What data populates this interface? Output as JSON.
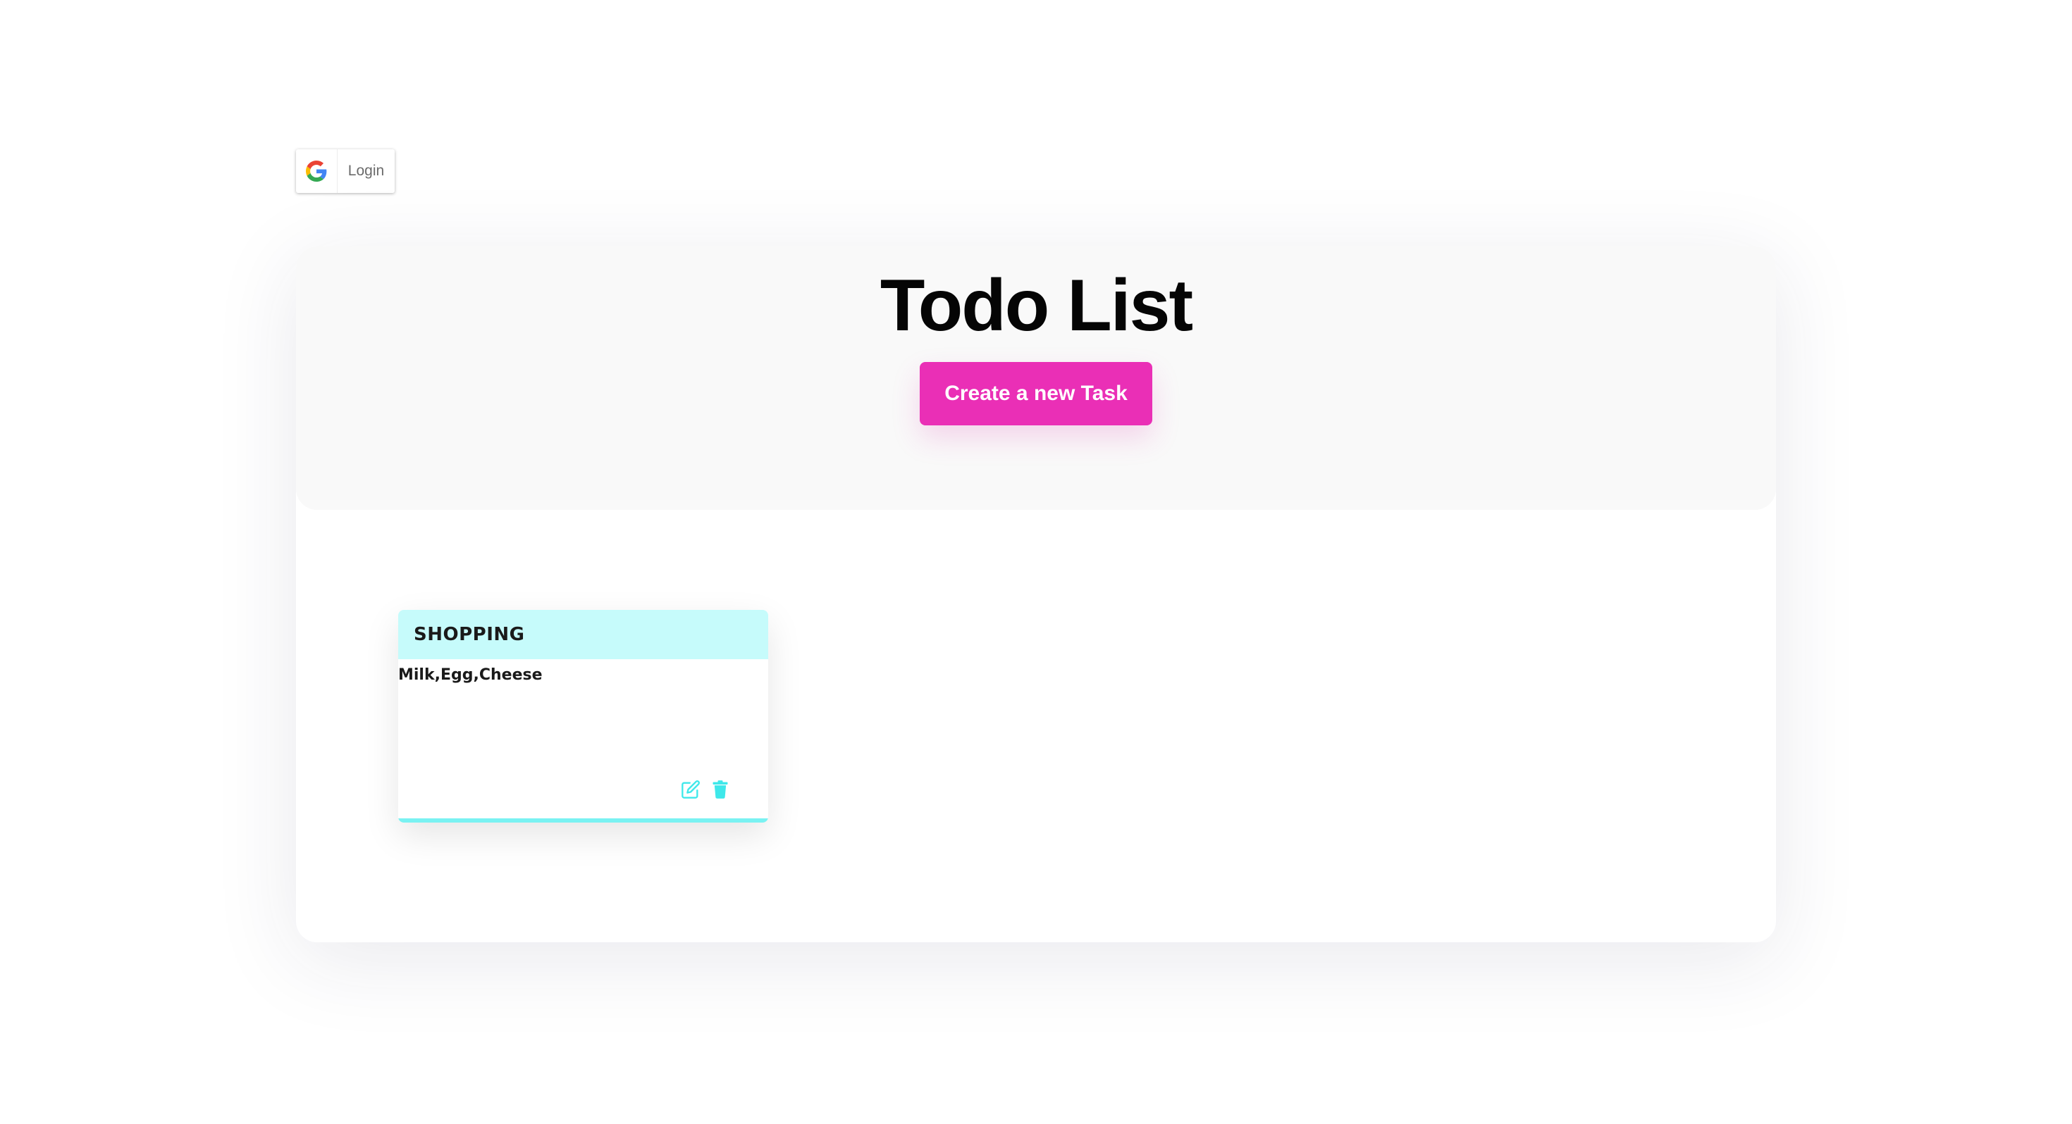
{
  "login": {
    "label": "Login",
    "icon": "google-icon"
  },
  "header": {
    "title": "Todo List",
    "create_button_label": "Create a new Task"
  },
  "tasks": [
    {
      "title": "SHOPPING",
      "description": "Milk,Egg,Cheese",
      "edit_icon": "edit-icon",
      "delete_icon": "trash-icon"
    }
  ],
  "colors": {
    "accent_pink": "#ea2fb6",
    "card_header_cyan": "#c6fbfb",
    "card_accent_cyan": "#3ee8ea",
    "header_bg": "#f9f9f9"
  }
}
